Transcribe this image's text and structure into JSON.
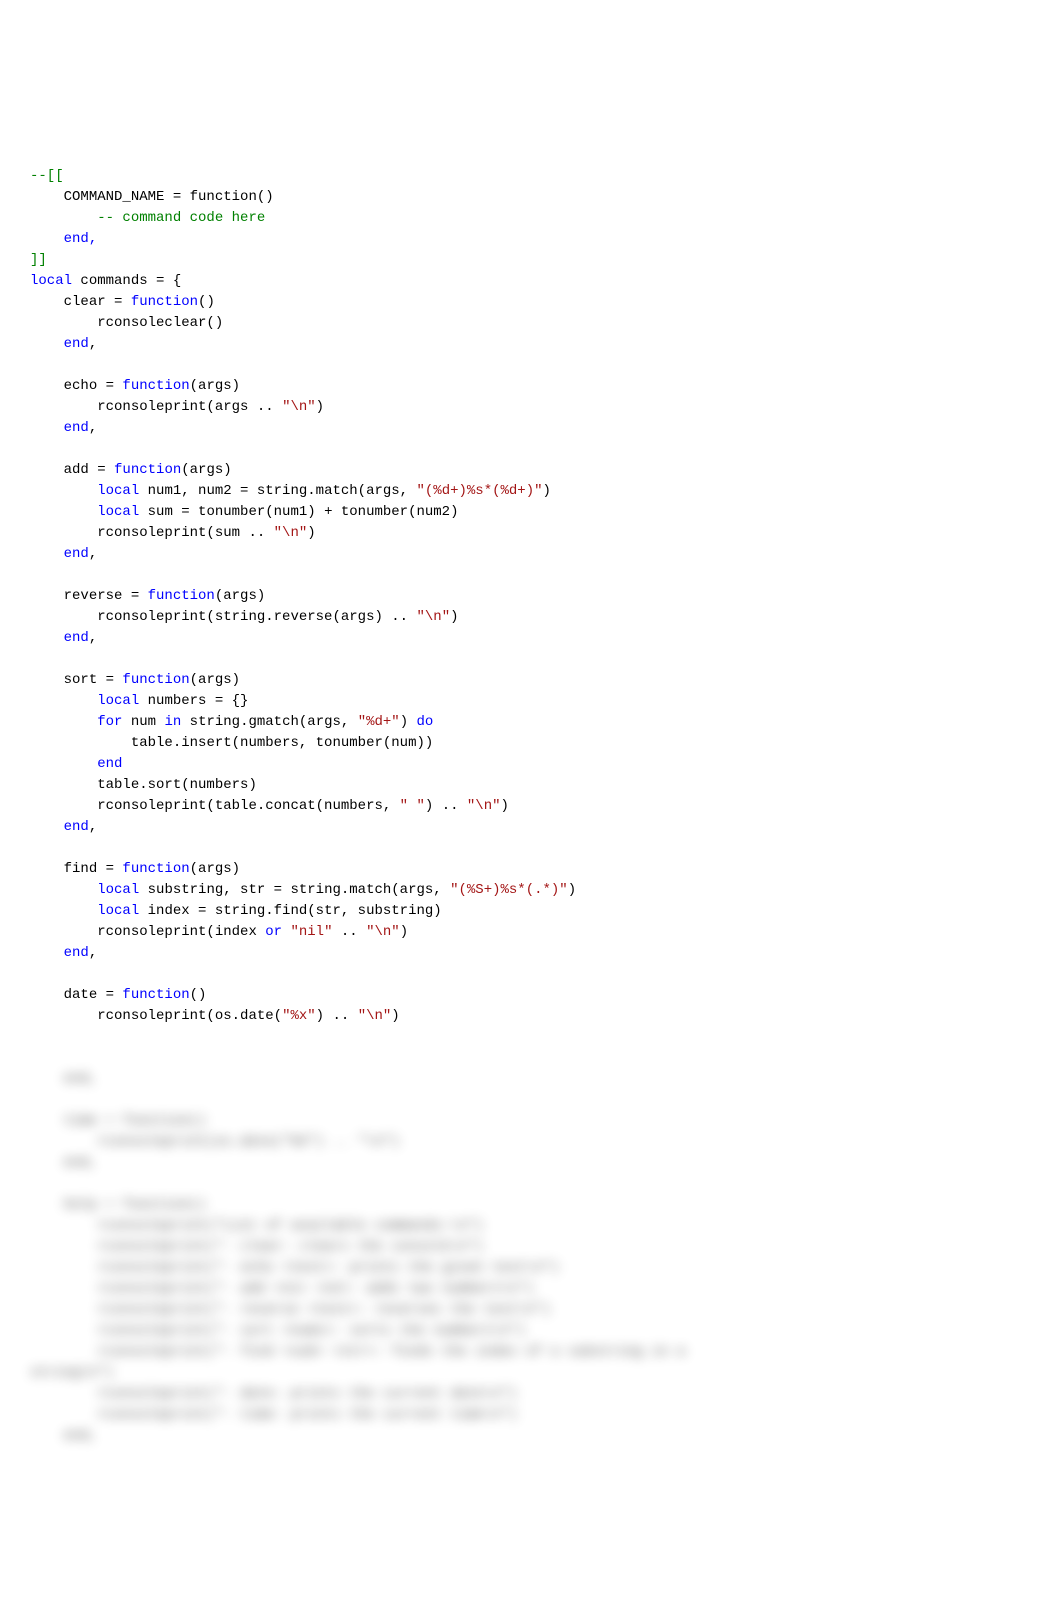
{
  "code": {
    "lines": [
      {
        "indent": 0,
        "type": "comment",
        "text": "--[["
      },
      {
        "indent": 1,
        "type": "plain",
        "text": "COMMAND_NAME = function()"
      },
      {
        "indent": 2,
        "type": "comment",
        "text": "-- command code here"
      },
      {
        "indent": 1,
        "type": "keyword",
        "text": "end,"
      },
      {
        "indent": 0,
        "type": "comment",
        "text": "]]"
      },
      {
        "indent": 0,
        "type": "mixed",
        "parts": [
          {
            "t": "keyword",
            "v": "local"
          },
          {
            "t": "plain",
            "v": " commands = {"
          }
        ]
      },
      {
        "indent": 1,
        "type": "mixed",
        "parts": [
          {
            "t": "plain",
            "v": "clear = "
          },
          {
            "t": "keyword",
            "v": "function"
          },
          {
            "t": "plain",
            "v": "()"
          }
        ]
      },
      {
        "indent": 2,
        "type": "plain",
        "text": "rconsoleclear()"
      },
      {
        "indent": 1,
        "type": "mixed",
        "parts": [
          {
            "t": "keyword",
            "v": "end"
          },
          {
            "t": "plain",
            "v": ","
          }
        ]
      },
      {
        "indent": 0,
        "type": "blank",
        "text": ""
      },
      {
        "indent": 1,
        "type": "mixed",
        "parts": [
          {
            "t": "plain",
            "v": "echo = "
          },
          {
            "t": "keyword",
            "v": "function"
          },
          {
            "t": "plain",
            "v": "(args)"
          }
        ]
      },
      {
        "indent": 2,
        "type": "mixed",
        "parts": [
          {
            "t": "plain",
            "v": "rconsoleprint(args .. "
          },
          {
            "t": "string",
            "v": "\"\\n\""
          },
          {
            "t": "plain",
            "v": ")"
          }
        ]
      },
      {
        "indent": 1,
        "type": "mixed",
        "parts": [
          {
            "t": "keyword",
            "v": "end"
          },
          {
            "t": "plain",
            "v": ","
          }
        ]
      },
      {
        "indent": 0,
        "type": "blank",
        "text": ""
      },
      {
        "indent": 1,
        "type": "mixed",
        "parts": [
          {
            "t": "plain",
            "v": "add = "
          },
          {
            "t": "keyword",
            "v": "function"
          },
          {
            "t": "plain",
            "v": "(args)"
          }
        ]
      },
      {
        "indent": 2,
        "type": "mixed",
        "parts": [
          {
            "t": "keyword",
            "v": "local"
          },
          {
            "t": "plain",
            "v": " num1, num2 = string.match(args, "
          },
          {
            "t": "string",
            "v": "\"(%d+)%s*(%d+)\""
          },
          {
            "t": "plain",
            "v": ")"
          }
        ]
      },
      {
        "indent": 2,
        "type": "mixed",
        "parts": [
          {
            "t": "keyword",
            "v": "local"
          },
          {
            "t": "plain",
            "v": " sum = tonumber(num1) + tonumber(num2)"
          }
        ]
      },
      {
        "indent": 2,
        "type": "mixed",
        "parts": [
          {
            "t": "plain",
            "v": "rconsoleprint(sum .. "
          },
          {
            "t": "string",
            "v": "\"\\n\""
          },
          {
            "t": "plain",
            "v": ")"
          }
        ]
      },
      {
        "indent": 1,
        "type": "mixed",
        "parts": [
          {
            "t": "keyword",
            "v": "end"
          },
          {
            "t": "plain",
            "v": ","
          }
        ]
      },
      {
        "indent": 0,
        "type": "blank",
        "text": ""
      },
      {
        "indent": 1,
        "type": "mixed",
        "parts": [
          {
            "t": "plain",
            "v": "reverse = "
          },
          {
            "t": "keyword",
            "v": "function"
          },
          {
            "t": "plain",
            "v": "(args)"
          }
        ]
      },
      {
        "indent": 2,
        "type": "mixed",
        "parts": [
          {
            "t": "plain",
            "v": "rconsoleprint(string.reverse(args) .. "
          },
          {
            "t": "string",
            "v": "\"\\n\""
          },
          {
            "t": "plain",
            "v": ")"
          }
        ]
      },
      {
        "indent": 1,
        "type": "mixed",
        "parts": [
          {
            "t": "keyword",
            "v": "end"
          },
          {
            "t": "plain",
            "v": ","
          }
        ]
      },
      {
        "indent": 0,
        "type": "blank",
        "text": ""
      },
      {
        "indent": 1,
        "type": "mixed",
        "parts": [
          {
            "t": "plain",
            "v": "sort = "
          },
          {
            "t": "keyword",
            "v": "function"
          },
          {
            "t": "plain",
            "v": "(args)"
          }
        ]
      },
      {
        "indent": 2,
        "type": "mixed",
        "parts": [
          {
            "t": "keyword",
            "v": "local"
          },
          {
            "t": "plain",
            "v": " numbers = {}"
          }
        ]
      },
      {
        "indent": 2,
        "type": "mixed",
        "parts": [
          {
            "t": "keyword",
            "v": "for"
          },
          {
            "t": "plain",
            "v": " num "
          },
          {
            "t": "keyword",
            "v": "in"
          },
          {
            "t": "plain",
            "v": " string.gmatch(args, "
          },
          {
            "t": "string",
            "v": "\"%d+\""
          },
          {
            "t": "plain",
            "v": ") "
          },
          {
            "t": "keyword",
            "v": "do"
          }
        ]
      },
      {
        "indent": 3,
        "type": "plain",
        "text": "table.insert(numbers, tonumber(num))"
      },
      {
        "indent": 2,
        "type": "keyword",
        "text": "end"
      },
      {
        "indent": 2,
        "type": "plain",
        "text": "table.sort(numbers)"
      },
      {
        "indent": 2,
        "type": "mixed",
        "parts": [
          {
            "t": "plain",
            "v": "rconsoleprint(table.concat(numbers, "
          },
          {
            "t": "string",
            "v": "\" \""
          },
          {
            "t": "plain",
            "v": ") .. "
          },
          {
            "t": "string",
            "v": "\"\\n\""
          },
          {
            "t": "plain",
            "v": ")"
          }
        ]
      },
      {
        "indent": 1,
        "type": "mixed",
        "parts": [
          {
            "t": "keyword",
            "v": "end"
          },
          {
            "t": "plain",
            "v": ","
          }
        ]
      },
      {
        "indent": 0,
        "type": "blank",
        "text": ""
      },
      {
        "indent": 1,
        "type": "mixed",
        "parts": [
          {
            "t": "plain",
            "v": "find = "
          },
          {
            "t": "keyword",
            "v": "function"
          },
          {
            "t": "plain",
            "v": "(args)"
          }
        ]
      },
      {
        "indent": 2,
        "type": "mixed",
        "parts": [
          {
            "t": "keyword",
            "v": "local"
          },
          {
            "t": "plain",
            "v": " substring, str = string.match(args, "
          },
          {
            "t": "string",
            "v": "\"(%S+)%s*(.*)\""
          },
          {
            "t": "plain",
            "v": ")"
          }
        ]
      },
      {
        "indent": 2,
        "type": "mixed",
        "parts": [
          {
            "t": "keyword",
            "v": "local"
          },
          {
            "t": "plain",
            "v": " index = string.find(str, substring)"
          }
        ]
      },
      {
        "indent": 2,
        "type": "mixed",
        "parts": [
          {
            "t": "plain",
            "v": "rconsoleprint(index "
          },
          {
            "t": "keyword",
            "v": "or"
          },
          {
            "t": "plain",
            "v": " "
          },
          {
            "t": "string",
            "v": "\"nil\""
          },
          {
            "t": "plain",
            "v": " .. "
          },
          {
            "t": "string",
            "v": "\"\\n\""
          },
          {
            "t": "plain",
            "v": ")"
          }
        ]
      },
      {
        "indent": 1,
        "type": "mixed",
        "parts": [
          {
            "t": "keyword",
            "v": "end"
          },
          {
            "t": "plain",
            "v": ","
          }
        ]
      },
      {
        "indent": 0,
        "type": "blank",
        "text": ""
      },
      {
        "indent": 1,
        "type": "mixed",
        "parts": [
          {
            "t": "plain",
            "v": "date = "
          },
          {
            "t": "keyword",
            "v": "function"
          },
          {
            "t": "plain",
            "v": "()"
          }
        ]
      },
      {
        "indent": 2,
        "type": "mixed",
        "parts": [
          {
            "t": "plain",
            "v": "rconsoleprint(os.date("
          },
          {
            "t": "string",
            "v": "\"%x\""
          },
          {
            "t": "plain",
            "v": ") .. "
          },
          {
            "t": "string",
            "v": "\"\\n\""
          },
          {
            "t": "plain",
            "v": ")"
          }
        ]
      }
    ],
    "blurred_lines": [
      {
        "indent": 1,
        "text": "end,"
      },
      {
        "indent": 0,
        "text": ""
      },
      {
        "indent": 1,
        "text": "time = function()"
      },
      {
        "indent": 2,
        "text": "rconsoleprint(os.date(\"%X\") .. \"\\n\")"
      },
      {
        "indent": 1,
        "text": "end,"
      },
      {
        "indent": 0,
        "text": ""
      },
      {
        "indent": 1,
        "text": "help = function()"
      },
      {
        "indent": 2,
        "text": "rconsoleprint(\"List of available commands:\\n\")"
      },
      {
        "indent": 2,
        "text": "rconsoleprint(\"- clear: clears the console\\n\")"
      },
      {
        "indent": 2,
        "text": "rconsoleprint(\"- echo <text>: prints the given text\\n\")"
      },
      {
        "indent": 2,
        "text": "rconsoleprint(\"- add <n1> <n2>: adds two numbers\\n\")"
      },
      {
        "indent": 2,
        "text": "rconsoleprint(\"- reverse <text>: reverses the text\\n\")"
      },
      {
        "indent": 2,
        "text": "rconsoleprint(\"- sort <nums>: sorts the numbers\\n\")"
      },
      {
        "indent": 2,
        "text": "rconsoleprint(\"- find <sub> <str>: finds the index of a substring in a"
      },
      {
        "indent": 0,
        "text": "string\\n\")"
      },
      {
        "indent": 2,
        "text": "rconsoleprint(\"- date: prints the current date\\n\")"
      },
      {
        "indent": 2,
        "text": "rconsoleprint(\"- time: prints the current time\\n\")"
      },
      {
        "indent": 1,
        "text": "end,"
      }
    ]
  },
  "indent_unit": "    "
}
